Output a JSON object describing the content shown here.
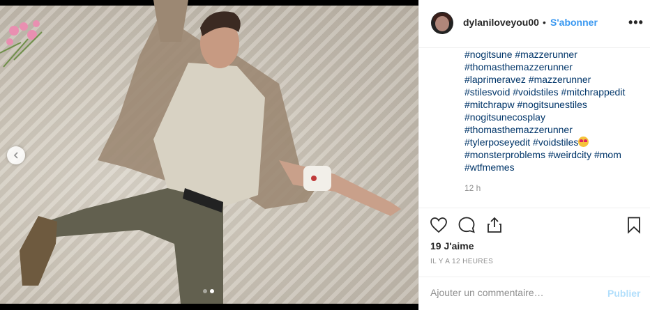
{
  "post": {
    "username": "dylaniloveyou00",
    "separator": "•",
    "follow_label": "S'abonner",
    "more_label": "•••",
    "caption_lines": [
      "#nogitsune #mazzerunner",
      "#thomasthemazzerunner",
      "#laprimeravez #mazzerunner",
      "#stilesvoid #voidstiles #mitchrappedit",
      "#mitchrapw #nogitsunestiles",
      "#nogitsunecosplay",
      "#thomasthemazzerunner",
      "#tylerposeyedit #voidstiles",
      "#monsterproblems #weirdcity #mom",
      "#wtfmemes"
    ],
    "caption_emoji": "heart-eyes-emoji",
    "relative_time": "12 h",
    "likes": "19 J'aime",
    "timestamp": "IL Y A 12 HEURES",
    "comment_placeholder": "Ajouter un commentaire…",
    "publish_label": "Publier"
  },
  "carousel": {
    "slide_count": 2,
    "active_slide": 2
  },
  "colors": {
    "link": "#003569",
    "follow": "#3897f0",
    "publish_disabled": "#b2dffc",
    "muted": "#8e8e8e"
  }
}
